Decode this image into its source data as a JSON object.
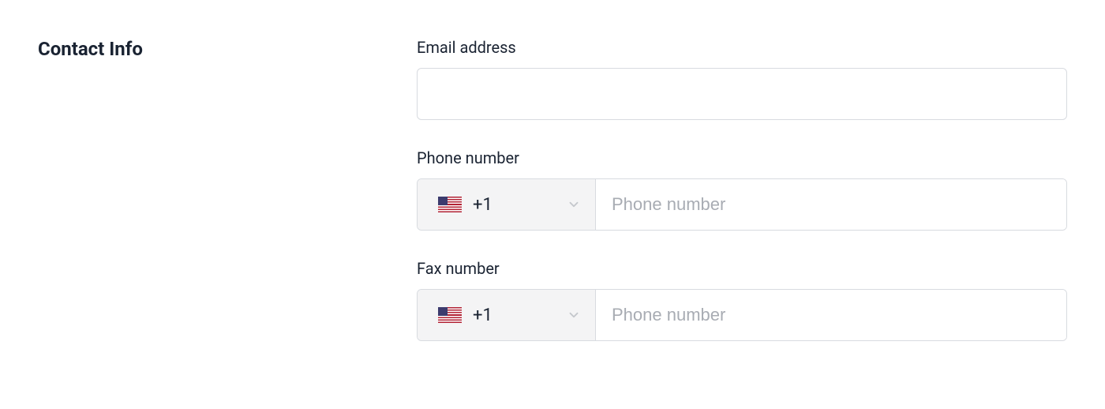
{
  "section": {
    "title": "Contact Info"
  },
  "email": {
    "label": "Email address",
    "value": ""
  },
  "phone": {
    "label": "Phone number",
    "country_code": "+1",
    "placeholder": "Phone number",
    "value": ""
  },
  "fax": {
    "label": "Fax number",
    "country_code": "+1",
    "placeholder": "Phone number",
    "value": ""
  }
}
